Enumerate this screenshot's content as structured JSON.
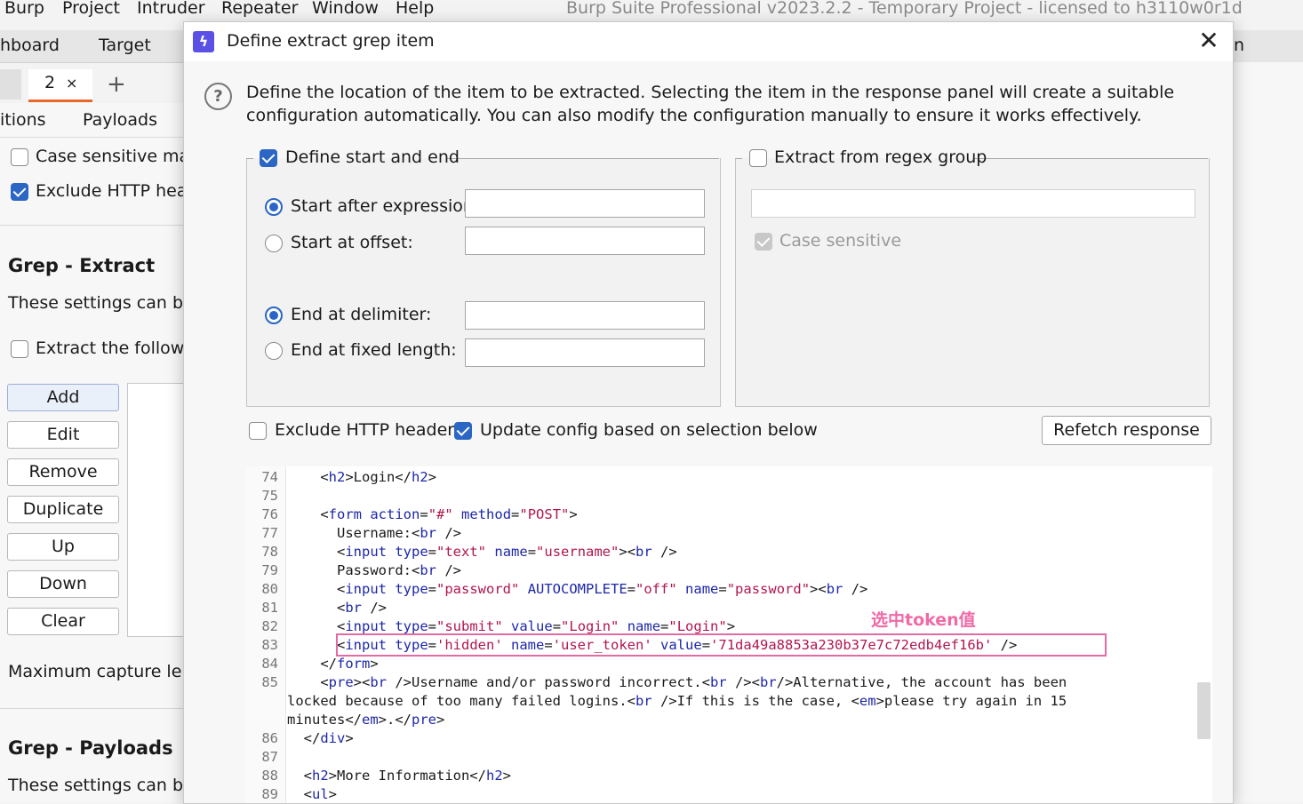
{
  "menu": [
    "Burp",
    "Project",
    "Intruder",
    "Repeater",
    "Window",
    "Help"
  ],
  "app_title": "Burp Suite Professional v2023.2.2 - Temporary Project - licensed to h3110w0r1d",
  "top_tabs": [
    "hboard",
    "Target",
    "n"
  ],
  "intruder_tab": {
    "number": "2",
    "close": "×",
    "add": "+"
  },
  "sub_tabs": [
    "itions",
    "Payloads"
  ],
  "left": {
    "case_sensitive": "Case sensitive matc",
    "exclude_http": "Exclude HTTP heade",
    "grep_extract_heading": "Grep - Extract",
    "grep_extract_desc": "These settings can be u",
    "extract_following": "Extract the followin",
    "buttons": [
      "Add",
      "Edit",
      "Remove",
      "Duplicate",
      "Up",
      "Down",
      "Clear"
    ],
    "max_capture": "Maximum capture leng",
    "grep_payloads_heading": "Grep - Payloads",
    "grep_payloads_desc": "These settings can be u"
  },
  "dialog": {
    "title": "Define extract grep item",
    "icon": "burp-lightning-icon",
    "close": "✕",
    "help": "?",
    "description": "Define the location of the item to be extracted. Selecting the item in the response panel will create a suitable configuration automatically. You can also modify the configuration manually to ensure it works effectively.",
    "define_start_end": "Define start and end",
    "start_after_expression": "Start after expression:",
    "start_at_offset": "Start at offset:",
    "end_at_delimiter": "End at delimiter:",
    "end_at_fixed_length": "End at fixed length:",
    "extract_regex": "Extract from regex group",
    "case_sensitive": "Case sensitive",
    "exclude_http_headers": "Exclude HTTP headers",
    "update_config": "Update config based on selection below",
    "refetch": "Refetch response",
    "annotation": "选中token值"
  },
  "code_lines": [
    {
      "n": "74",
      "html": "    &lt;<span class='t'>h2</span>&gt;Login&lt;/<span class='t'>h2</span>&gt;"
    },
    {
      "n": "75",
      "html": ""
    },
    {
      "n": "76",
      "html": "    &lt;<span class='t'>form</span> <span class='a'>action</span>=<span class='v'>\"#\"</span> <span class='a'>method</span>=<span class='v'>\"POST\"</span>&gt;"
    },
    {
      "n": "77",
      "html": "      Username:&lt;<span class='t'>br</span> /&gt;"
    },
    {
      "n": "78",
      "html": "      &lt;<span class='t'>input</span> <span class='a'>type</span>=<span class='v'>\"text\"</span> <span class='a'>name</span>=<span class='v'>\"username\"</span>&gt;&lt;<span class='t'>br</span> /&gt;"
    },
    {
      "n": "79",
      "html": "      Password:&lt;<span class='t'>br</span> /&gt;"
    },
    {
      "n": "80",
      "html": "      &lt;<span class='t'>input</span> <span class='a'>type</span>=<span class='v'>\"password\"</span> <span class='a'>AUTOCOMPLETE</span>=<span class='v'>\"off\"</span> <span class='a'>name</span>=<span class='v'>\"password\"</span>&gt;&lt;<span class='t'>br</span> /&gt;"
    },
    {
      "n": "81",
      "html": "      &lt;<span class='t'>br</span> /&gt;"
    },
    {
      "n": "82",
      "html": "      &lt;<span class='t'>input</span> <span class='a'>type</span>=<span class='v'>\"submit\"</span> <span class='a'>value</span>=<span class='v'>\"Login\"</span> <span class='a'>name</span>=<span class='v'>\"Login\"</span>&gt;"
    },
    {
      "n": "83",
      "html": "      &lt;<span class='t'>input</span> <span class='a'>type</span>=<span class='v'>'hidden'</span> <span class='a'>name</span>=<span class='v'>'user_token'</span> <span class='a'>value</span>=<span class='v'>'71da49a8853a230b37e7c72edb4ef16b'</span> /&gt;"
    },
    {
      "n": "84",
      "html": "    &lt;/<span class='t'>form</span>&gt;"
    },
    {
      "n": "85",
      "html": "    &lt;<span class='t'>pre</span>&gt;&lt;<span class='t'>br</span> /&gt;Username and/or password incorrect.&lt;<span class='t'>br</span> /&gt;&lt;<span class='t'>br</span>/&gt;Alternative, the account has been"
    },
    {
      "n": "",
      "html": "locked because of too many failed logins.&lt;<span class='t'>br</span> /&gt;If this is the case, &lt;<span class='t'>em</span>&gt;please try again in 15"
    },
    {
      "n": "",
      "html": "minutes&lt;/<span class='t'>em</span>&gt;.&lt;/<span class='t'>pre</span>&gt;"
    },
    {
      "n": "86",
      "html": "  &lt;/<span class='t'>div</span>&gt;"
    },
    {
      "n": "87",
      "html": ""
    },
    {
      "n": "88",
      "html": "  &lt;<span class='t'>h2</span>&gt;More Information&lt;/<span class='t'>h2</span>&gt;"
    },
    {
      "n": "89",
      "html": "  &lt;<span class='t'>ul</span>&gt;"
    }
  ],
  "colors": {
    "accent": "#2b66c4",
    "tab_underline": "#e8692a",
    "highlight": "#e36ba2",
    "tag": "#1d27a8",
    "value": "#b0174f"
  }
}
